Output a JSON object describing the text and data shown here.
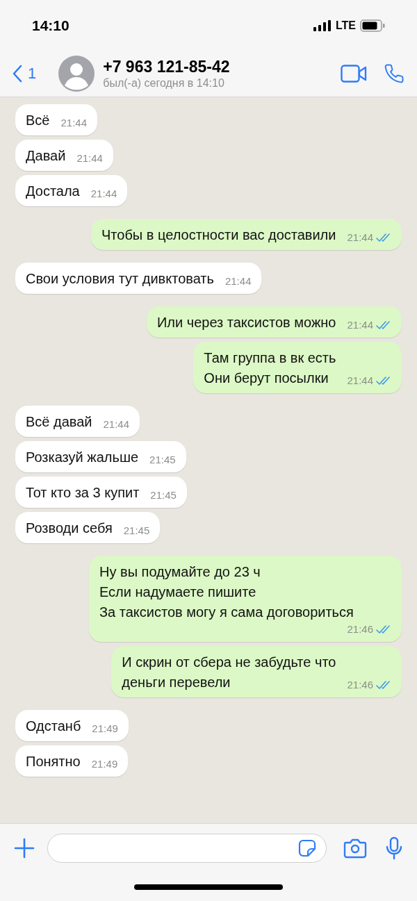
{
  "status_bar": {
    "time": "14:10",
    "network": "LTE"
  },
  "header": {
    "back_count": "1",
    "contact": "+7 963 121-85-42",
    "last_seen": "был(-а) сегодня в 14:10"
  },
  "messages": [
    {
      "kind": "in",
      "lines": [
        "Всё"
      ],
      "time": "21:44"
    },
    {
      "kind": "in",
      "lines": [
        "Давай"
      ],
      "time": "21:44"
    },
    {
      "kind": "in",
      "lines": [
        "Достала"
      ],
      "time": "21:44"
    },
    {
      "kind": "out",
      "lines": [
        "Чтобы в целостности вас доставили"
      ],
      "time": "21:44",
      "read": true
    },
    {
      "kind": "in",
      "lines": [
        "Свои условия тут дивктовать"
      ],
      "time": "21:44"
    },
    {
      "kind": "out",
      "lines": [
        "Или через таксистов можно"
      ],
      "time": "21:44",
      "read": true
    },
    {
      "kind": "out",
      "lines": [
        "Там группа в вк есть",
        "Они берут посылки"
      ],
      "time": "21:44",
      "read": true
    },
    {
      "kind": "in",
      "lines": [
        "Всё давай"
      ],
      "time": "21:44"
    },
    {
      "kind": "in",
      "lines": [
        "Розказуй жальше"
      ],
      "time": "21:45"
    },
    {
      "kind": "in",
      "lines": [
        "Тот кто за 3 купит"
      ],
      "time": "21:45"
    },
    {
      "kind": "in",
      "lines": [
        "Розводи себя"
      ],
      "time": "21:45"
    },
    {
      "kind": "out",
      "lines": [
        "Ну вы подумайте до 23 ч",
        "Если надумаете пишите",
        "За таксистов могу я сама договориться"
      ],
      "time": "21:46",
      "read": true
    },
    {
      "kind": "out",
      "lines": [
        "И скрин от сбера не забудьте что",
        "деньги перевели"
      ],
      "time": "21:46",
      "read": true
    },
    {
      "kind": "in",
      "lines": [
        "Одстанб"
      ],
      "time": "21:49"
    },
    {
      "kind": "in",
      "lines": [
        "Понятно"
      ],
      "time": "21:49"
    }
  ]
}
